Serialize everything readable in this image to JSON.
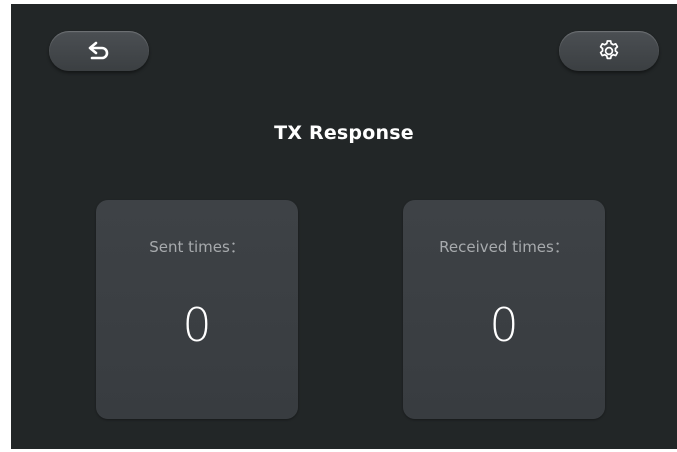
{
  "header": {
    "back_icon": "back-arrow-icon",
    "settings_icon": "gear-icon"
  },
  "title": "TX Response",
  "stats": {
    "sent": {
      "label": "Sent times：",
      "value": "0"
    },
    "received": {
      "label": "Received times：",
      "value": "0"
    }
  },
  "colors": {
    "background": "#222627",
    "card": "#3c4044",
    "button": "#43474a",
    "label": "#a7aaad",
    "text": "#ffffff"
  }
}
